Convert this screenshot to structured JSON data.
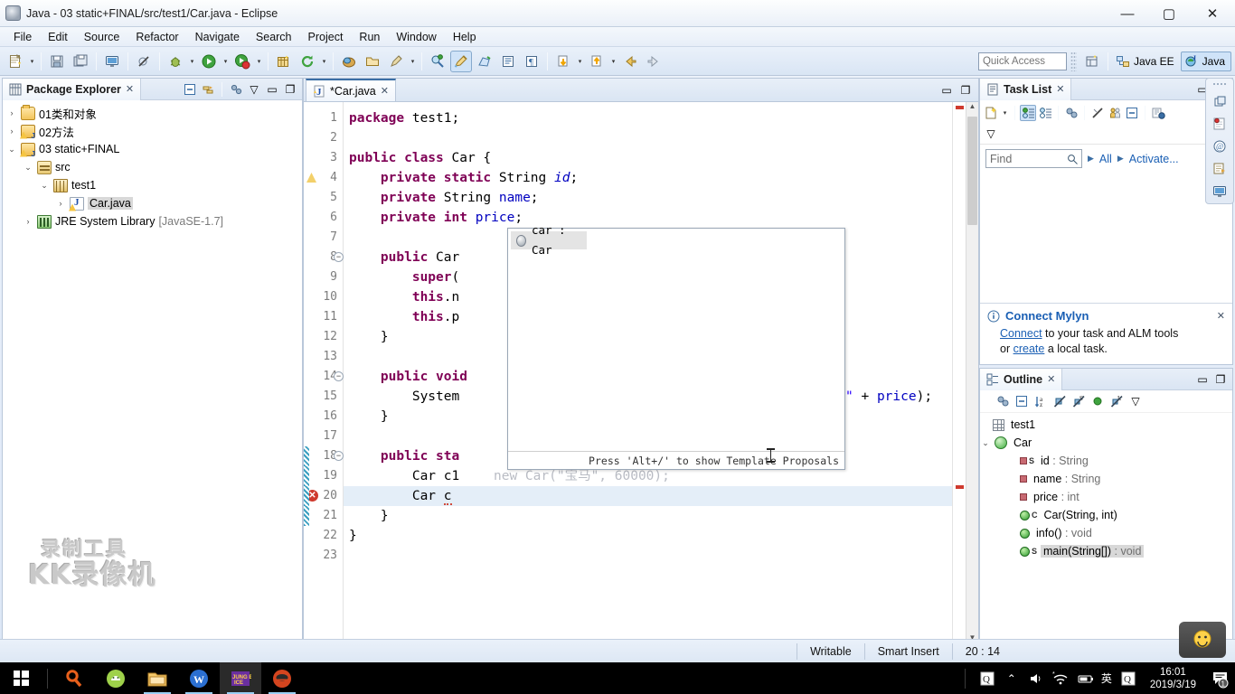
{
  "window": {
    "title": "Java - 03 static+FINAL/src/test1/Car.java - Eclipse",
    "minimize": "—",
    "maximize": "▢",
    "close": "✕"
  },
  "menu": [
    "File",
    "Edit",
    "Source",
    "Refactor",
    "Navigate",
    "Search",
    "Project",
    "Run",
    "Window",
    "Help"
  ],
  "toolbar": {
    "quick_access_placeholder": "Quick Access",
    "perspectives": [
      {
        "label": "Java EE",
        "active": false
      },
      {
        "label": "Java",
        "active": true
      }
    ]
  },
  "package_explorer": {
    "title": "Package Explorer",
    "close": "✕",
    "tree": [
      {
        "label": "01类和对象",
        "indent": 1,
        "arrow": "›",
        "icon": "folder-icon",
        "warn": false,
        "selected": false,
        "dim": ""
      },
      {
        "label": "02方法",
        "indent": 1,
        "arrow": "›",
        "icon": "java-project-icon",
        "warn": true,
        "selected": false,
        "dim": ""
      },
      {
        "label": "03 static+FINAL",
        "indent": 1,
        "arrow": "⌄",
        "icon": "java-project-icon",
        "warn": true,
        "selected": false,
        "dim": ""
      },
      {
        "label": "src",
        "indent": 2,
        "arrow": "⌄",
        "icon": "source-folder-icon",
        "warn": false,
        "selected": false,
        "dim": ""
      },
      {
        "label": "test1",
        "indent": 3,
        "arrow": "⌄",
        "icon": "package-icon",
        "warn": false,
        "selected": false,
        "dim": ""
      },
      {
        "label": "Car.java",
        "indent": 4,
        "arrow": "›",
        "icon": "java-file-icon",
        "warn": true,
        "selected": true,
        "dim": ""
      },
      {
        "label": "JRE System Library",
        "indent": 2,
        "arrow": "›",
        "icon": "library-icon",
        "warn": false,
        "selected": false,
        "dim": "[JavaSE-1.7]"
      }
    ]
  },
  "editor": {
    "tab_label": "*Car.java",
    "tab_close": "✕",
    "lines": [
      {
        "n": 1,
        "segments": [
          {
            "t": "package",
            "c": "kw"
          },
          {
            "t": " test1;",
            "c": "plain"
          }
        ]
      },
      {
        "n": 2,
        "segments": []
      },
      {
        "n": 3,
        "segments": [
          {
            "t": "public class",
            "c": "kw"
          },
          {
            "t": " Car {",
            "c": "plain"
          }
        ]
      },
      {
        "n": 4,
        "segments": [
          {
            "t": "    ",
            "c": "plain"
          },
          {
            "t": "private static",
            "c": "kw"
          },
          {
            "t": " String ",
            "c": "plain"
          },
          {
            "t": "id",
            "c": "sfld"
          },
          {
            "t": ";",
            "c": "plain"
          }
        ]
      },
      {
        "n": 5,
        "segments": [
          {
            "t": "    ",
            "c": "plain"
          },
          {
            "t": "private",
            "c": "kw"
          },
          {
            "t": " String ",
            "c": "plain"
          },
          {
            "t": "name",
            "c": "fld"
          },
          {
            "t": ";",
            "c": "plain"
          }
        ]
      },
      {
        "n": 6,
        "segments": [
          {
            "t": "    ",
            "c": "plain"
          },
          {
            "t": "private int",
            "c": "kw"
          },
          {
            "t": " ",
            "c": "plain"
          },
          {
            "t": "price",
            "c": "fld"
          },
          {
            "t": ";",
            "c": "plain"
          }
        ]
      },
      {
        "n": 7,
        "segments": []
      },
      {
        "n": 8,
        "segments": [
          {
            "t": "    ",
            "c": "plain"
          },
          {
            "t": "public",
            "c": "kw"
          },
          {
            "t": " Car",
            "c": "plain"
          }
        ]
      },
      {
        "n": 9,
        "segments": [
          {
            "t": "        ",
            "c": "plain"
          },
          {
            "t": "super",
            "c": "kw"
          },
          {
            "t": "(",
            "c": "plain"
          }
        ]
      },
      {
        "n": 10,
        "segments": [
          {
            "t": "        ",
            "c": "plain"
          },
          {
            "t": "this",
            "c": "kw"
          },
          {
            "t": ".n",
            "c": "plain"
          }
        ]
      },
      {
        "n": 11,
        "segments": [
          {
            "t": "        ",
            "c": "plain"
          },
          {
            "t": "this",
            "c": "kw"
          },
          {
            "t": ".p",
            "c": "plain"
          }
        ]
      },
      {
        "n": 12,
        "segments": [
          {
            "t": "    }",
            "c": "plain"
          }
        ]
      },
      {
        "n": 13,
        "segments": []
      },
      {
        "n": 14,
        "segments": [
          {
            "t": "    ",
            "c": "plain"
          },
          {
            "t": "public void",
            "c": "kw"
          },
          {
            "t": "",
            "c": "plain"
          }
        ]
      },
      {
        "n": 15,
        "segments": [
          {
            "t": "        System",
            "c": "plain"
          }
        ]
      },
      {
        "n": 16,
        "segments": [
          {
            "t": "    }",
            "c": "plain"
          }
        ]
      },
      {
        "n": 17,
        "segments": []
      },
      {
        "n": 18,
        "segments": [
          {
            "t": "    ",
            "c": "plain"
          },
          {
            "t": "public sta",
            "c": "kw"
          }
        ]
      },
      {
        "n": 19,
        "segments": [
          {
            "t": "        Car c1",
            "c": "plain"
          }
        ]
      },
      {
        "n": 20,
        "segments": [
          {
            "t": "        Car ",
            "c": "plain"
          },
          {
            "t": "c",
            "c": "err"
          }
        ]
      },
      {
        "n": 21,
        "segments": [
          {
            "t": "    }",
            "c": "plain"
          }
        ]
      },
      {
        "n": 22,
        "segments": [
          {
            "t": "}",
            "c": "plain"
          }
        ]
      },
      {
        "n": 23,
        "segments": []
      }
    ],
    "line15_tail": "\" + price);",
    "line19_ghost": "new Car(\"宝马\", 60000);",
    "markers": {
      "warn_line": 4,
      "error_line": 20
    },
    "folds": [
      8,
      14,
      18
    ],
    "current_line": 20
  },
  "content_assist": {
    "proposals": [
      {
        "label": "car : Car",
        "icon": "local-variable-icon"
      }
    ],
    "footer": "Press 'Alt+/' to show Template Proposals"
  },
  "task_list": {
    "title": "Task List",
    "close": "✕",
    "find_placeholder": "Find",
    "filter_all": "All",
    "activate": "Activate...",
    "mylyn": {
      "heading": "Connect Mylyn",
      "close": "✕",
      "line1_link": "Connect",
      "line1_rest": " to your task and ALM tools",
      "line2_pre": "or ",
      "line2_link": "create",
      "line2_rest": " a local task."
    }
  },
  "outline": {
    "title": "Outline",
    "close": "✕",
    "items": [
      {
        "name": "test1",
        "type": "",
        "icon": "package-icon",
        "indent": 1,
        "arrow": "",
        "kind": "pkg",
        "selected": false,
        "static": false
      },
      {
        "name": "Car",
        "type": "",
        "icon": "class-icon",
        "indent": 1,
        "arrow": "⌄",
        "kind": "class",
        "selected": false,
        "static": false
      },
      {
        "name": "id",
        "type": " : String",
        "icon": "field-icon",
        "indent": 2,
        "arrow": "",
        "kind": "field",
        "selected": false,
        "static": true
      },
      {
        "name": "name",
        "type": " : String",
        "icon": "field-icon",
        "indent": 2,
        "arrow": "",
        "kind": "field",
        "selected": false,
        "static": false
      },
      {
        "name": "price",
        "type": " : int",
        "icon": "field-icon",
        "indent": 2,
        "arrow": "",
        "kind": "field",
        "selected": false,
        "static": false
      },
      {
        "name": "Car(String, int)",
        "type": "",
        "icon": "constructor-icon",
        "indent": 2,
        "arrow": "",
        "kind": "method",
        "selected": false,
        "static": false,
        "ctor": true
      },
      {
        "name": "info()",
        "type": " : void",
        "icon": "method-icon",
        "indent": 2,
        "arrow": "",
        "kind": "method",
        "selected": false,
        "static": false
      },
      {
        "name": "main(String[])",
        "type": " : void",
        "icon": "method-icon",
        "indent": 2,
        "arrow": "",
        "kind": "method",
        "selected": true,
        "static": true
      }
    ]
  },
  "status_bar": {
    "writable": "Writable",
    "insert_mode": "Smart Insert",
    "position": "20 : 14"
  },
  "watermark": {
    "line1": "录制工具",
    "line2": "KK录像机"
  },
  "taskbar": {
    "clock_time": "16:01",
    "clock_date": "2019/3/19",
    "ime": "英",
    "notification_count": "1"
  },
  "colors": {
    "keyword": "#7f0055",
    "field": "#0000c0",
    "string": "#2a00ff",
    "link": "#1a5fb4",
    "accent": "#3a6ea5"
  }
}
